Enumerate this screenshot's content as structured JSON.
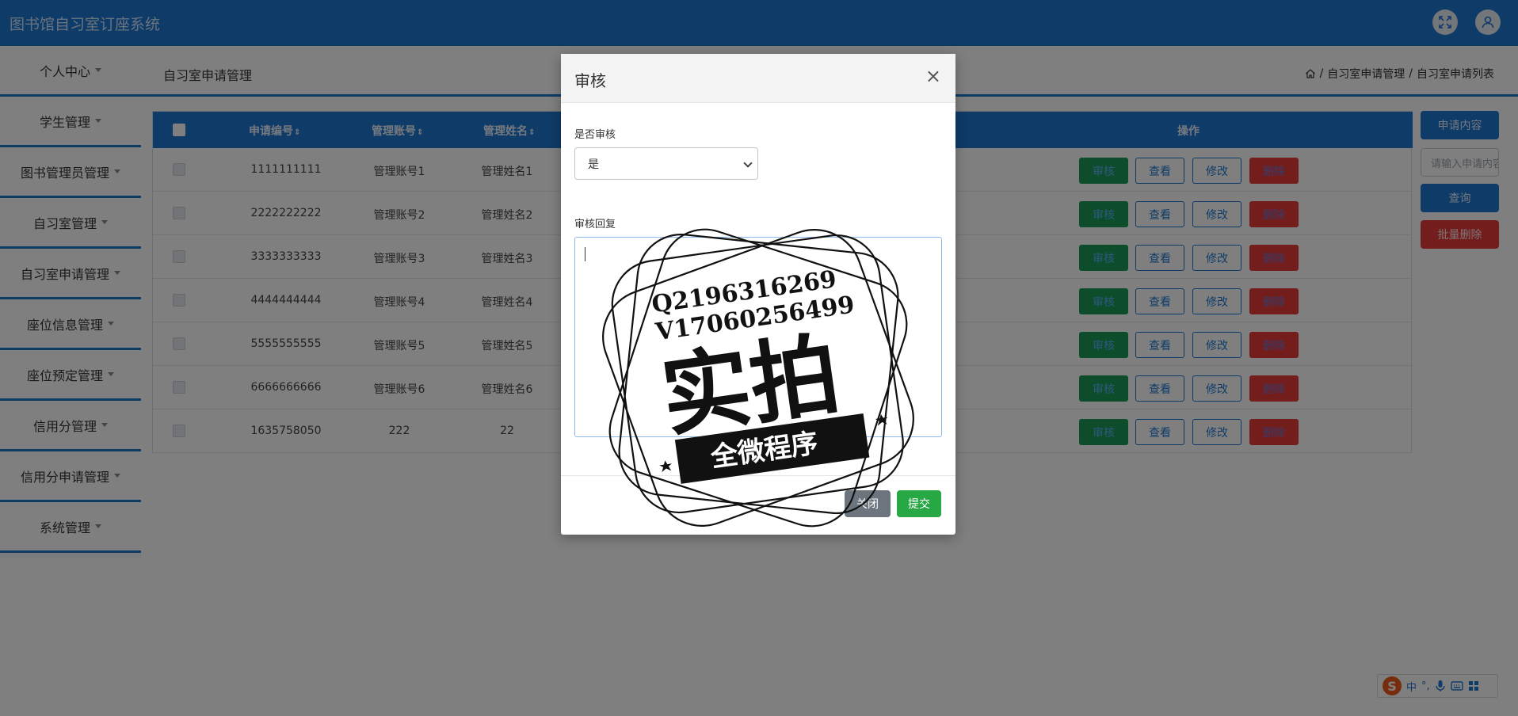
{
  "app": {
    "title": "图书馆自习室订座系统"
  },
  "header": {
    "fullscreen_icon": "fullscreen-icon",
    "user_icon": "user-icon"
  },
  "sidebar": {
    "items": [
      {
        "label": "个人中心"
      },
      {
        "label": "学生管理"
      },
      {
        "label": "图书管理员管理"
      },
      {
        "label": "自习室管理"
      },
      {
        "label": "自习室申请管理"
      },
      {
        "label": "座位信息管理"
      },
      {
        "label": "座位预定管理"
      },
      {
        "label": "信用分管理"
      },
      {
        "label": "信用分申请管理"
      },
      {
        "label": "系统管理"
      }
    ]
  },
  "page": {
    "title": "自习室申请管理",
    "breadcrumb": [
      "自习室申请管理",
      "自习室申请列表"
    ],
    "breadcrumb_sep": "/"
  },
  "table": {
    "columns": {
      "apply_no": "申请编号",
      "account": "管理账号",
      "name": "管理姓名",
      "actions": "操作"
    },
    "sort_mark": "⇕",
    "rows": [
      {
        "apply_no": "1111111111",
        "account": "管理账号1",
        "name": "管理姓名1"
      },
      {
        "apply_no": "2222222222",
        "account": "管理账号2",
        "name": "管理姓名2"
      },
      {
        "apply_no": "3333333333",
        "account": "管理账号3",
        "name": "管理姓名3"
      },
      {
        "apply_no": "4444444444",
        "account": "管理账号4",
        "name": "管理姓名4"
      },
      {
        "apply_no": "5555555555",
        "account": "管理账号5",
        "name": "管理姓名5"
      },
      {
        "apply_no": "6666666666",
        "account": "管理账号6",
        "name": "管理姓名6"
      },
      {
        "apply_no": "1635758050",
        "account": "222",
        "name": "22"
      }
    ],
    "row_buttons": {
      "audit": "审核",
      "view": "查看",
      "edit": "修改",
      "delete": "删除"
    }
  },
  "search": {
    "label_button": "申请内容",
    "placeholder": "请输入申请内容",
    "query_button": "查询",
    "batch_delete_button": "批量删除"
  },
  "modal": {
    "title": "审核",
    "close_glyph": "×",
    "audit_label": "是否审核",
    "audit_value": "是",
    "reply_label": "审核回复",
    "reply_value": "",
    "close_button": "关闭",
    "submit_button": "提交"
  },
  "watermark": {
    "line1": "Q2196316269",
    "line2": "V17060256499",
    "big": "实拍",
    "banner": "全微程序"
  },
  "ime": {
    "logo": "S",
    "mode": "中",
    "punct": "°,",
    "mic_icon": "mic-icon",
    "keyboard_icon": "keyboard-icon",
    "grid_icon": "grid-icon"
  },
  "colors": {
    "primary": "#1f77d0",
    "success": "#28a745",
    "danger": "#e63a3a",
    "secondary": "#6c757d"
  }
}
